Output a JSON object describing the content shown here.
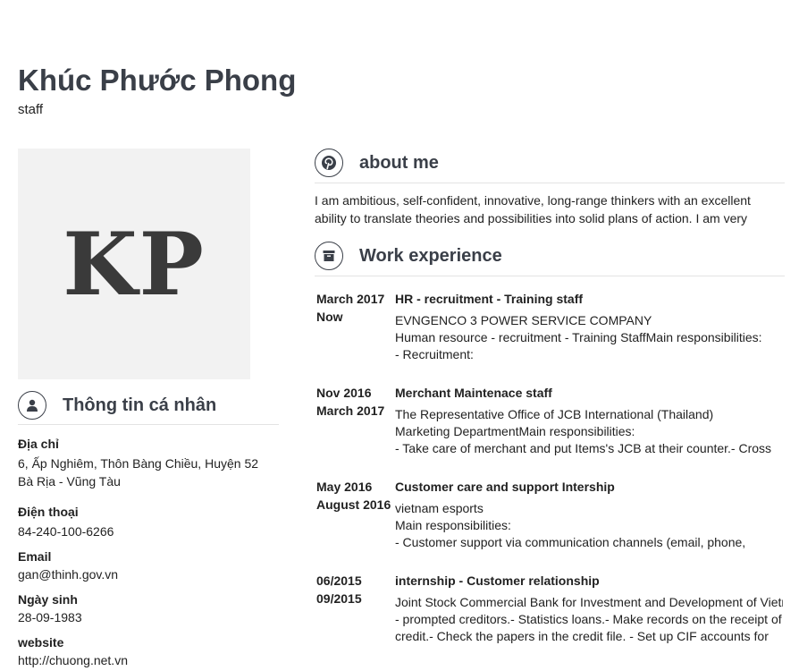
{
  "profile": {
    "name": "Khúc Phước Phong",
    "role": "staff",
    "initials": "KP"
  },
  "personal": {
    "title": "Thông tin cá nhân",
    "address_label": "Địa chỉ",
    "address_line1": "6, Ấp Nghiêm, Thôn Bàng Chiều, Huyện 52",
    "address_line2": "Bà Rịa - Vũng Tàu",
    "phone_label": "Điện thoại",
    "phone": "84-240-100-6266",
    "email_label": "Email",
    "email": "gan@thinh.gov.vn",
    "birthday_label": "Ngày sinh",
    "birthday": "28-09-1983",
    "website_label": "website",
    "website": "http://chuong.net.vn"
  },
  "about": {
    "title": "about me",
    "line1": "I am ambitious, self-confident, innovative, long-range thinkers with an excellent",
    "line2": "ability to translate theories and possibilities into solid plans of action. I am very"
  },
  "work": {
    "title": "Work experience",
    "jobs": [
      {
        "start": "March 2017",
        "end": "Now",
        "title": "HR - recruitment - Training staff",
        "company": "EVNGENCO 3 POWER SERVICE COMPANY",
        "desc1": "Human resource - recruitment - Training StaffMain responsibilities:",
        "desc2": "- Recruitment:"
      },
      {
        "start": "Nov 2016",
        "end": "March 2017",
        "title": "Merchant Maintenace staff",
        "company": "The Representative Office of JCB International (Thailand)",
        "desc1": "Marketing DepartmentMain responsibilities:",
        "desc2": "- Take care of merchant and put Items's JCB at their counter.- Cross"
      },
      {
        "start": "May 2016",
        "end": "August 2016",
        "title": "Customer care and support Intership",
        "company": "vietnam esports",
        "desc1": "Main responsibilities:",
        "desc2": "- Customer support via communication channels (email, phone,"
      },
      {
        "start": "06/2015",
        "end": "09/2015",
        "title": "internship - Customer relationship",
        "company": "Joint Stock Commercial Bank for Investment and Development of Vietnam",
        "desc1": "- prompted creditors.- Statistics loans.- Make records on the receipt of",
        "desc2": "credit.- Check the papers in the credit file. - Set up CIF accounts for"
      }
    ]
  },
  "colors": {
    "heading": "#3a3f48",
    "avatar_bg": "#f2f2f2",
    "divider": "#e3e3e3"
  },
  "icons": {
    "personal": "user-icon",
    "about": "pinterest-icon",
    "work": "archive-icon"
  }
}
